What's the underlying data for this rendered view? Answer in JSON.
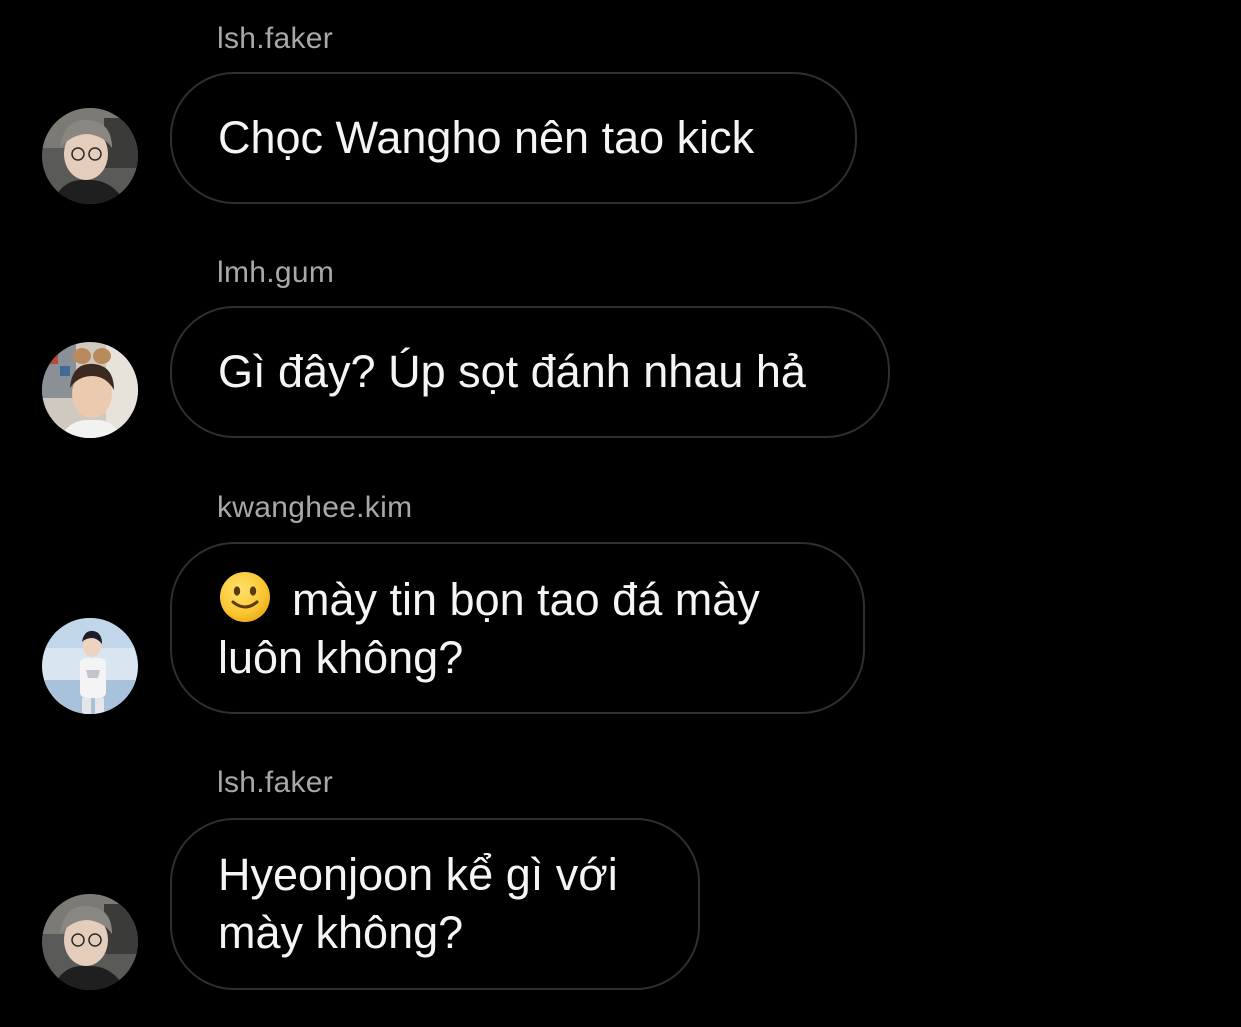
{
  "messages": [
    {
      "sender": "lsh.faker",
      "text": "Chọc Wangho nên tao kick",
      "avatar_icon": "faker-avatar"
    },
    {
      "sender": "lmh.gum",
      "text": "Gì đây? Úp sọt đánh nhau hả",
      "avatar_icon": "gumayusi-avatar"
    },
    {
      "sender": "kwanghee.kim",
      "emoji": "slightly-smiling-face",
      "text": "mày tin bọn tao đá mày\nluôn không?",
      "avatar_icon": "kwanghee-avatar"
    },
    {
      "sender": "lsh.faker",
      "text": "Hyeonjoon kể gì với\nmày không?",
      "avatar_icon": "faker-avatar"
    }
  ],
  "colors": {
    "background": "#000000",
    "bubble_border": "#2f2f2f",
    "sender_text": "#a8a8a8",
    "message_text": "#f5f5f5"
  }
}
